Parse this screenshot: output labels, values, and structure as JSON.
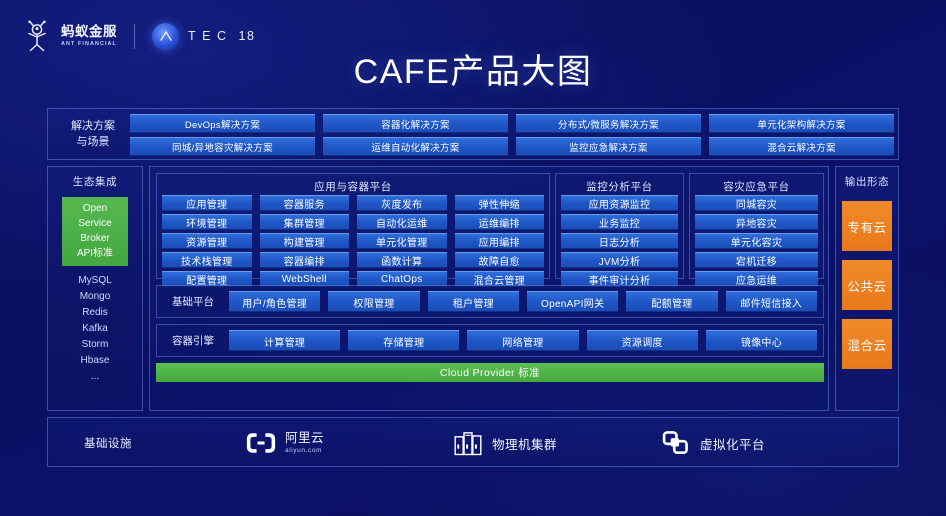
{
  "header": {
    "brand_cn": "蚂蚁金服",
    "brand_en": "ANT FINANCIAL",
    "brand_icon": "ant-logo-icon",
    "atec_icon": "atec-orb-icon",
    "atec_word": "TEC",
    "atec_number": "18"
  },
  "title": "CAFE产品大图",
  "solutions": {
    "label": "解决方案\n与场景",
    "label_line1": "解决方案",
    "label_line2": "与场景",
    "row1": [
      "DevOps解决方案",
      "容器化解决方案",
      "分布式/微服务解决方案",
      "单元化架构解决方案"
    ],
    "row2": [
      "同城/异地容灾解决方案",
      "运维自动化解决方案",
      "监控应急解决方案",
      "混合云解决方案"
    ]
  },
  "ecosystem": {
    "title": "生态集成",
    "standard": [
      "Open",
      "Service",
      "Broker",
      "API标准"
    ],
    "items": [
      "MySQL",
      "Mongo",
      "Redis",
      "Kafka",
      "Storm",
      "Hbase",
      "..."
    ]
  },
  "app_container_platform": {
    "title": "应用与容器平台",
    "items": [
      "应用管理",
      "容器服务",
      "灰度发布",
      "弹性伸缩",
      "环境管理",
      "集群管理",
      "自动化运维",
      "运维编排",
      "资源管理",
      "构建管理",
      "单元化管理",
      "应用编排",
      "技术栈管理",
      "容器编排",
      "函数计算",
      "故障自愈",
      "配置管理",
      "WebShell",
      "ChatOps",
      "混合云管理"
    ]
  },
  "monitor_platform": {
    "title": "监控分析平台",
    "items": [
      "应用资源监控",
      "业务监控",
      "日志分析",
      "JVM分析",
      "事件审计分析"
    ]
  },
  "disaster_platform": {
    "title": "容灾应急平台",
    "items": [
      "同城容灾",
      "异地容灾",
      "单元化容灾",
      "宕机迁移",
      "应急运维"
    ]
  },
  "base_platform": {
    "label": "基础平台",
    "items": [
      "用户/角色管理",
      "权限管理",
      "租户管理",
      "OpenAPI网关",
      "配额管理",
      "邮件短信接入"
    ]
  },
  "container_engine": {
    "label": "容器引擎",
    "items": [
      "计算管理",
      "存储管理",
      "网络管理",
      "资源调度",
      "镜像中心"
    ]
  },
  "cloud_provider_bar": "Cloud Provider 标准",
  "output": {
    "title": "输出形态",
    "items": [
      "专有云",
      "公共云",
      "混合云"
    ]
  },
  "infrastructure": {
    "label": "基础设施",
    "items": [
      {
        "name": "阿里云",
        "sub": "aliyun.com",
        "icon": "aliyun-logo-icon"
      },
      {
        "name": "物理机集群",
        "sub": "",
        "icon": "server-rack-icon"
      },
      {
        "name": "虚拟化平台",
        "sub": "",
        "icon": "virtualization-icon"
      }
    ]
  },
  "colors": {
    "background": "#0a1060",
    "chip_blue": "#2f6fdd",
    "accent_green": "#4caf50",
    "accent_orange": "#e8791b",
    "panel_border": "#78a0ff"
  }
}
